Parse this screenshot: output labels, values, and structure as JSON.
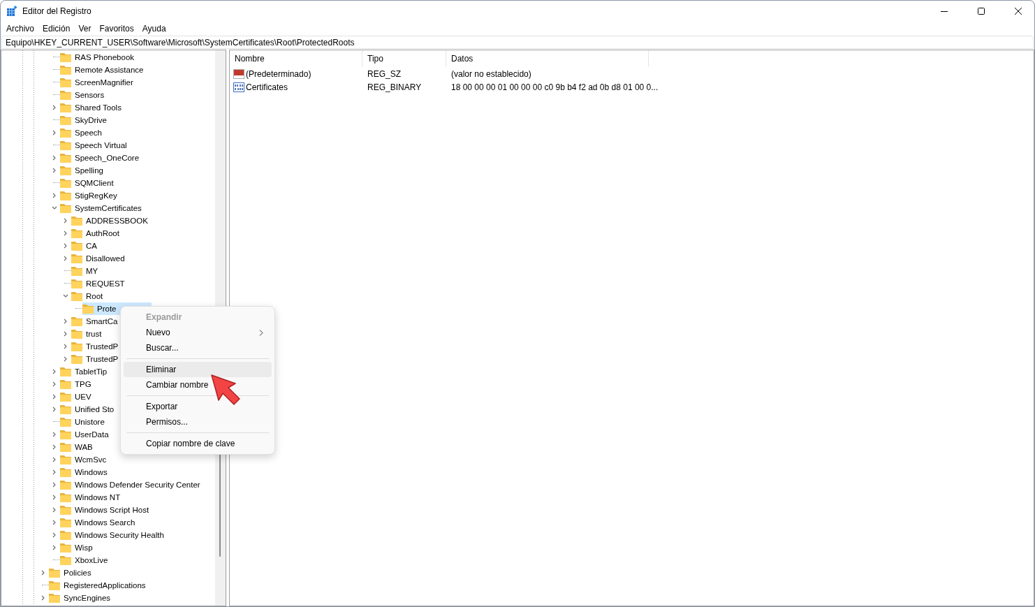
{
  "window": {
    "title": "Editor del Registro"
  },
  "menu_bar": [
    "Archivo",
    "Edición",
    "Ver",
    "Favoritos",
    "Ayuda"
  ],
  "address": "Equipo\\HKEY_CURRENT_USER\\Software\\Microsoft\\SystemCertificates\\Root\\ProtectedRoots",
  "tree": {
    "continued_branch": [
      {
        "label": "RAS Phonebook",
        "expandable": false,
        "selected": false
      },
      {
        "label": "Remote Assistance",
        "expandable": false,
        "selected": false
      },
      {
        "label": "ScreenMagnifier",
        "expandable": false,
        "selected": false
      },
      {
        "label": "Sensors",
        "expandable": false,
        "selected": false
      },
      {
        "label": "Shared Tools",
        "expandable": true,
        "expanded": false,
        "selected": false
      },
      {
        "label": "SkyDrive",
        "expandable": false,
        "selected": false
      },
      {
        "label": "Speech",
        "expandable": true,
        "expanded": false,
        "selected": false
      },
      {
        "label": "Speech Virtual",
        "expandable": false,
        "selected": false
      },
      {
        "label": "Speech_OneCore",
        "expandable": true,
        "expanded": false,
        "selected": false
      },
      {
        "label": "Spelling",
        "expandable": true,
        "expanded": false,
        "selected": false
      },
      {
        "label": "SQMClient",
        "expandable": false,
        "selected": false
      },
      {
        "label": "StigRegKey",
        "expandable": true,
        "expanded": false,
        "selected": false
      },
      {
        "label": "SystemCertificates",
        "expandable": true,
        "expanded": true,
        "selected": false,
        "children": [
          {
            "label": "ADDRESSBOOK",
            "expandable": true,
            "expanded": false,
            "selected": false
          },
          {
            "label": "AuthRoot",
            "expandable": true,
            "expanded": false,
            "selected": false
          },
          {
            "label": "CA",
            "expandable": true,
            "expanded": false,
            "selected": false
          },
          {
            "label": "Disallowed",
            "expandable": true,
            "expanded": false,
            "selected": false
          },
          {
            "label": "MY",
            "expandable": false,
            "selected": false
          },
          {
            "label": "REQUEST",
            "expandable": false,
            "selected": false
          },
          {
            "label": "Root",
            "expandable": true,
            "expanded": true,
            "selected": false,
            "children": [
              {
                "label": "Prote",
                "expandable": false,
                "selected": true
              }
            ]
          },
          {
            "label": "SmartCa",
            "expandable": true,
            "expanded": false,
            "selected": false
          },
          {
            "label": "trust",
            "expandable": true,
            "expanded": false,
            "selected": false
          },
          {
            "label": "TrustedP",
            "expandable": true,
            "expanded": false,
            "selected": false
          },
          {
            "label": "TrustedP",
            "expandable": true,
            "expanded": false,
            "selected": false
          }
        ]
      },
      {
        "label": "TabletTip",
        "expandable": true,
        "expanded": false,
        "selected": false
      },
      {
        "label": "TPG",
        "expandable": true,
        "expanded": false,
        "selected": false
      },
      {
        "label": "UEV",
        "expandable": true,
        "expanded": false,
        "selected": false
      },
      {
        "label": "Unified Sto",
        "expandable": true,
        "expanded": false,
        "selected": false
      },
      {
        "label": "Unistore",
        "expandable": false,
        "selected": false
      },
      {
        "label": "UserData",
        "expandable": true,
        "expanded": false,
        "selected": false
      },
      {
        "label": "WAB",
        "expandable": true,
        "expanded": false,
        "selected": false
      },
      {
        "label": "WcmSvc",
        "expandable": true,
        "expanded": false,
        "selected": false
      },
      {
        "label": "Windows",
        "expandable": true,
        "expanded": false,
        "selected": false
      },
      {
        "label": "Windows Defender Security Center",
        "expandable": true,
        "expanded": false,
        "selected": false
      },
      {
        "label": "Windows NT",
        "expandable": true,
        "expanded": false,
        "selected": false
      },
      {
        "label": "Windows Script Host",
        "expandable": true,
        "expanded": false,
        "selected": false
      },
      {
        "label": "Windows Search",
        "expandable": true,
        "expanded": false,
        "selected": false
      },
      {
        "label": "Windows Security Health",
        "expandable": true,
        "expanded": false,
        "selected": false
      },
      {
        "label": "Wisp",
        "expandable": true,
        "expanded": false,
        "selected": false
      },
      {
        "label": "XboxLive",
        "expandable": false,
        "selected": false
      }
    ],
    "items": [
      {
        "label": "Policies",
        "expandable": true,
        "expanded": false,
        "selected": false
      },
      {
        "label": "RegisteredApplications",
        "expandable": false,
        "selected": false
      },
      {
        "label": "SyncEngines",
        "expandable": true,
        "expanded": false,
        "selected": false
      }
    ]
  },
  "values_table": {
    "columns": [
      "Nombre",
      "Tipo",
      "Datos"
    ],
    "rows": [
      {
        "kind": "string",
        "name": "(Predeterminado)",
        "type": "REG_SZ",
        "data": "(valor no establecido)"
      },
      {
        "kind": "binary",
        "name": "Certificates",
        "type": "REG_BINARY",
        "data": "18 00 00 00 01 00 00 00 c0 9b b4 f2 ad 0b d8 01 00 0..."
      }
    ]
  },
  "context_menu": [
    {
      "kind": "item",
      "label": "Expandir",
      "disabled": true,
      "selected": false,
      "submenu": false
    },
    {
      "kind": "item",
      "label": "Nuevo",
      "disabled": false,
      "selected": false,
      "submenu": true
    },
    {
      "kind": "item",
      "label": "Buscar...",
      "disabled": false,
      "selected": false,
      "submenu": false
    },
    {
      "kind": "separator"
    },
    {
      "kind": "item",
      "label": "Eliminar",
      "disabled": false,
      "selected": true,
      "submenu": false
    },
    {
      "kind": "item",
      "label": "Cambiar nombre",
      "disabled": false,
      "selected": false,
      "submenu": false
    },
    {
      "kind": "separator"
    },
    {
      "kind": "item",
      "label": "Exportar",
      "disabled": false,
      "selected": false,
      "submenu": false
    },
    {
      "kind": "item",
      "label": "Permisos...",
      "disabled": false,
      "selected": false,
      "submenu": false
    },
    {
      "kind": "separator"
    },
    {
      "kind": "item",
      "label": "Copiar nombre de clave",
      "disabled": false,
      "selected": false,
      "submenu": false
    }
  ]
}
